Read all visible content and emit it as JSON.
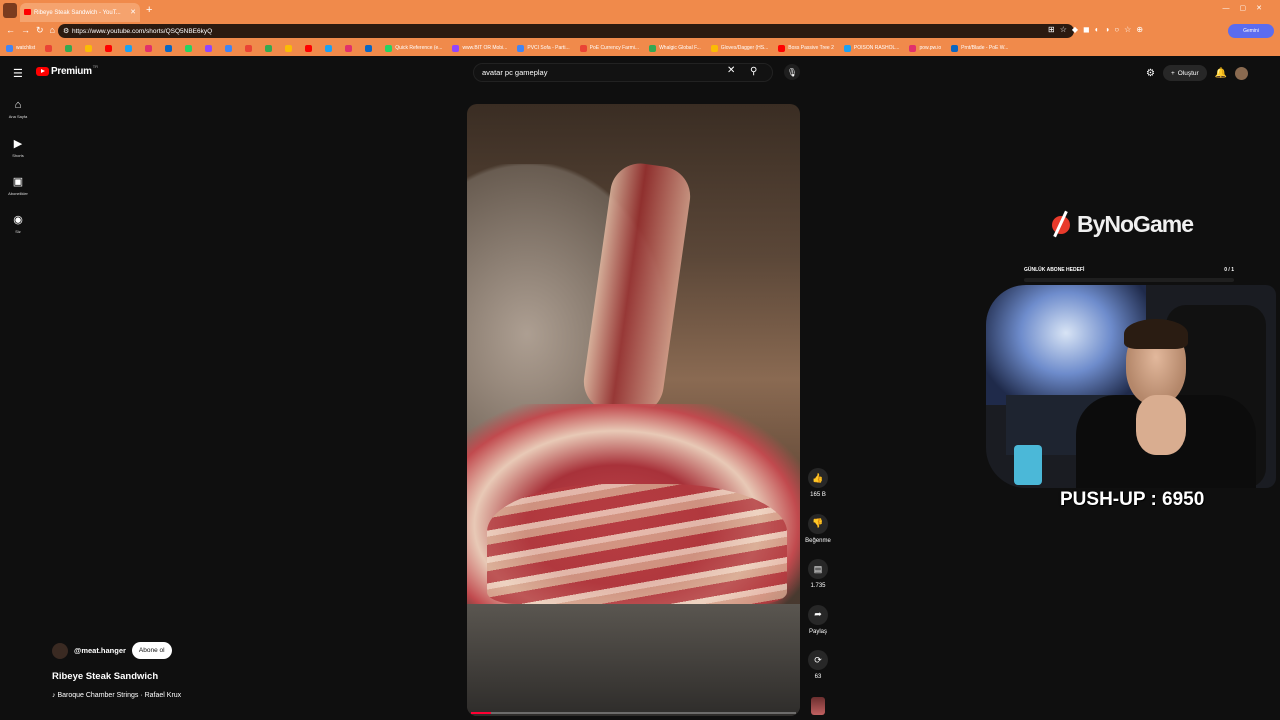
{
  "browser": {
    "tab_title": "Ribeye Steak Sandwich - YouT...",
    "url": "https://www.youtube.com/shorts/QSQ5NBE6kyQ",
    "bookmarks": [
      "watchlist",
      "",
      "",
      "",
      "",
      "",
      "",
      "",
      "",
      "",
      "",
      "",
      "",
      "",
      "",
      "",
      "",
      "",
      "Quick Reference (e...",
      "www.BIT OR Mobi...",
      "PVCI Sofa - Parti...",
      "PoE Currency Farmi...",
      "Whalgic Global F...",
      "Gloves/Dagger (HS...",
      "Boss Passive Tree 2",
      "POISON RASHOL...",
      "pow.pw.io",
      "Prnt/Blade - PoE W..."
    ],
    "gemini_label": "Gemini"
  },
  "youtube": {
    "logo_text": "Premium",
    "logo_region": "TR",
    "search_value": "avatar pc gameplay",
    "create_label": "Oluştur",
    "sidenav": [
      {
        "icon": "home-icon",
        "glyph": "⌂",
        "label": "Ana Sayfa"
      },
      {
        "icon": "shorts-icon",
        "glyph": "▶",
        "label": "Shorts"
      },
      {
        "icon": "subscriptions-icon",
        "glyph": "▣",
        "label": "Abonelikler"
      },
      {
        "icon": "you-icon",
        "glyph": "◉",
        "label": "Siz"
      }
    ]
  },
  "short": {
    "progress_fraction": 0.06,
    "likes": "165 B",
    "dislike_label": "Beğenme",
    "comments": "1.735",
    "share_label": "Paylaş",
    "remix_count": "63",
    "channel": "@meat.hanger",
    "subscribe_label": "Abone ol",
    "title": "Ribeye Steak Sandwich",
    "music": "♪ Baroque Chamber Strings · Rafael Krux"
  },
  "stream_overlay": {
    "brand": "ByNoGame",
    "goal_label": "GÜNLÜK ABONE HEDEFİ",
    "goal_value": "0 / 1",
    "pushup_text": "PUSH-UP : 6950"
  }
}
